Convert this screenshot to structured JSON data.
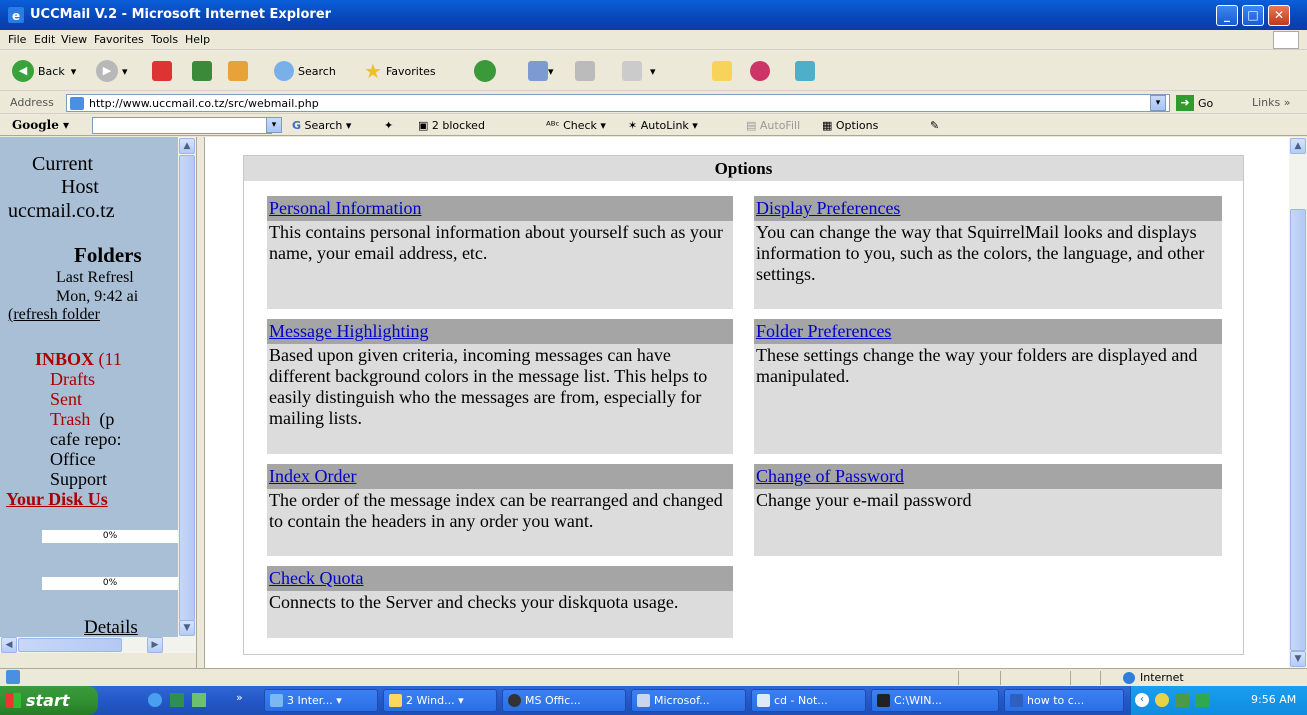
{
  "window": {
    "title": "UCCMail V.2 - Microsoft Internet Explorer"
  },
  "menu": [
    "File",
    "Edit",
    "View",
    "Favorites",
    "Tools",
    "Help"
  ],
  "toolbar": {
    "back": "Back",
    "search": "Search",
    "favorites": "Favorites"
  },
  "address": {
    "label": "Address",
    "url": "http://www.uccmail.co.tz/src/webmail.php",
    "go": "Go",
    "links": "Links"
  },
  "google_bar": {
    "logo": "Google",
    "search": "Search",
    "blocked": "2 blocked",
    "check": "Check",
    "autolink": "AutoLink",
    "autofill": "AutoFill",
    "options": "Options"
  },
  "sidebar": {
    "current": "Current",
    "host": "Host",
    "hostname": "uccmail.co.tz",
    "folders_title": "Folders",
    "last_refresh": "Last Refresl",
    "refresh_time": "Mon, 9:42 ai",
    "refresh_link": "(refresh folder",
    "inbox": "INBOX",
    "inbox_count": "(11",
    "drafts": "Drafts",
    "sent": "Sent",
    "trash": "Trash",
    "trash_suffix": "(p",
    "cafe": "cafe repo:",
    "office": "Office",
    "support": "Support",
    "disk_usage": "Your Disk Us",
    "quota1": "0%",
    "quota2": "0%",
    "details": "Details"
  },
  "options": {
    "title": "Options",
    "items": [
      {
        "label": "Personal Information",
        "desc": "This contains personal information about yourself such as your name, your email address, etc."
      },
      {
        "label": "Display Preferences",
        "desc": "You can change the way that SquirrelMail looks and displays information to you, such as the colors, the language, and other settings."
      },
      {
        "label": "Message Highlighting",
        "desc": "Based upon given criteria, incoming messages can have different background colors in the message list. This helps to easily distinguish who the messages are from, especially for mailing lists."
      },
      {
        "label": "Folder Preferences",
        "desc": "These settings change the way your folders are displayed and manipulated."
      },
      {
        "label": "Index Order",
        "desc": "The order of the message index can be rearranged and changed to contain the headers in any order you want."
      },
      {
        "label": "Change of Password",
        "desc": "Change your e-mail password"
      },
      {
        "label": "Check Quota",
        "desc": "Connects to the Server and checks your diskquota usage."
      }
    ]
  },
  "status": {
    "zone": "Internet"
  },
  "taskbar": {
    "start": "start",
    "tasks": [
      "3 Inter...",
      "2 Wind...",
      "MS Offic...",
      "Microsof...",
      "cd - Not...",
      "C:\\WIN...",
      "how to c..."
    ],
    "clock": "9:56 AM"
  },
  "colors": {
    "title_bar": "#0846b8",
    "sidebar_bg": "#a9bfd6",
    "option_header": "#a5a5a5",
    "option_body": "#dcdcdc",
    "link": "#0000cc",
    "folder_red": "#aa0000"
  }
}
